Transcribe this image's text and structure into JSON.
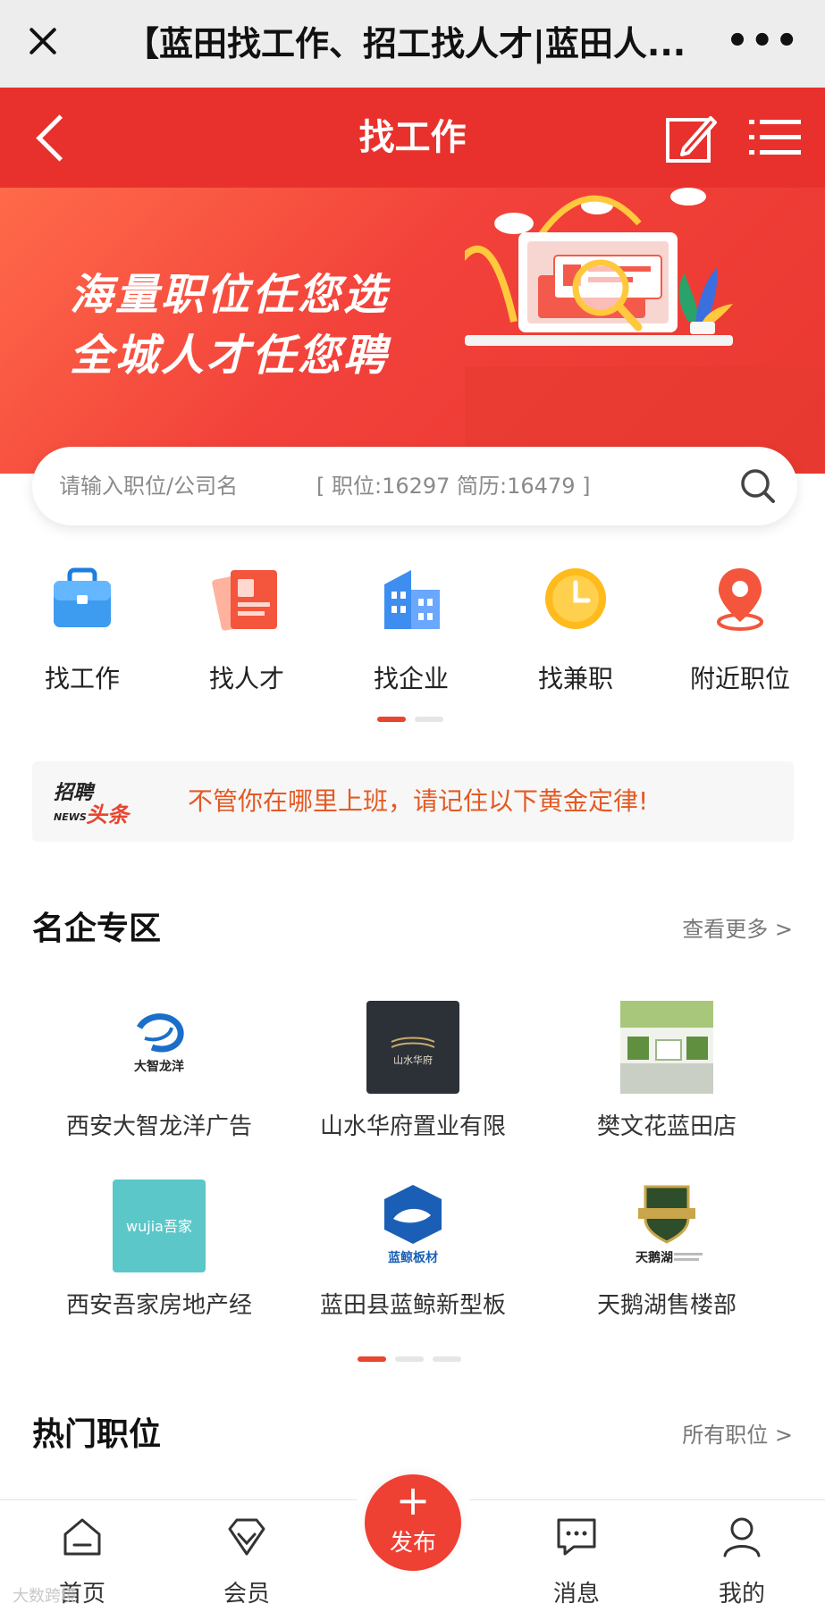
{
  "wechat": {
    "title": "【蓝田找工作、招工找人才|蓝田人...",
    "more": "•••"
  },
  "header": {
    "title": "找工作"
  },
  "banner": {
    "line1": "海量职位任您选",
    "line2": "全城人才任您聘"
  },
  "search": {
    "placeholder": "请输入职位/公司名",
    "stats": "[ 职位:16297   简历:16479 ]"
  },
  "quick_nav": [
    {
      "label": "找工作",
      "icon": "briefcase-icon"
    },
    {
      "label": "找人才",
      "icon": "resume-icon"
    },
    {
      "label": "找企业",
      "icon": "building-icon"
    },
    {
      "label": "找兼职",
      "icon": "clock-icon"
    },
    {
      "label": "附近职位",
      "icon": "location-pin-icon"
    }
  ],
  "headline": {
    "logo_top": "招聘",
    "logo_news": "NEWS",
    "logo_bottom": "头条",
    "text": "不管你在哪里上班，请记住以下黄金定律!"
  },
  "famous": {
    "title": "名企专区",
    "more": "查看更多 >",
    "items": [
      {
        "name": "西安大智龙洋广告",
        "logo_text": "大智龙洋"
      },
      {
        "name": "山水华府置业有限",
        "logo_text": "山水华府"
      },
      {
        "name": "樊文花蓝田店",
        "logo_text": ""
      },
      {
        "name": "西安吾家房地产经",
        "logo_text": "wujia吾家"
      },
      {
        "name": "蓝田县蓝鲸新型板",
        "logo_text": "蓝鲸板材"
      },
      {
        "name": "天鹅湖售楼部",
        "logo_text": "天鹅湖"
      }
    ]
  },
  "hot": {
    "title": "热门职位",
    "more": "所有职位 >"
  },
  "tabbar": {
    "home": "首页",
    "member": "会员",
    "publish_plus": "+",
    "publish": "发布",
    "messages": "消息",
    "mine": "我的"
  },
  "watermark": "大数跨境",
  "colors": {
    "brand_red": "#e8312d",
    "accent_orange": "#e35a24",
    "wechat_bar": "#ededed"
  }
}
